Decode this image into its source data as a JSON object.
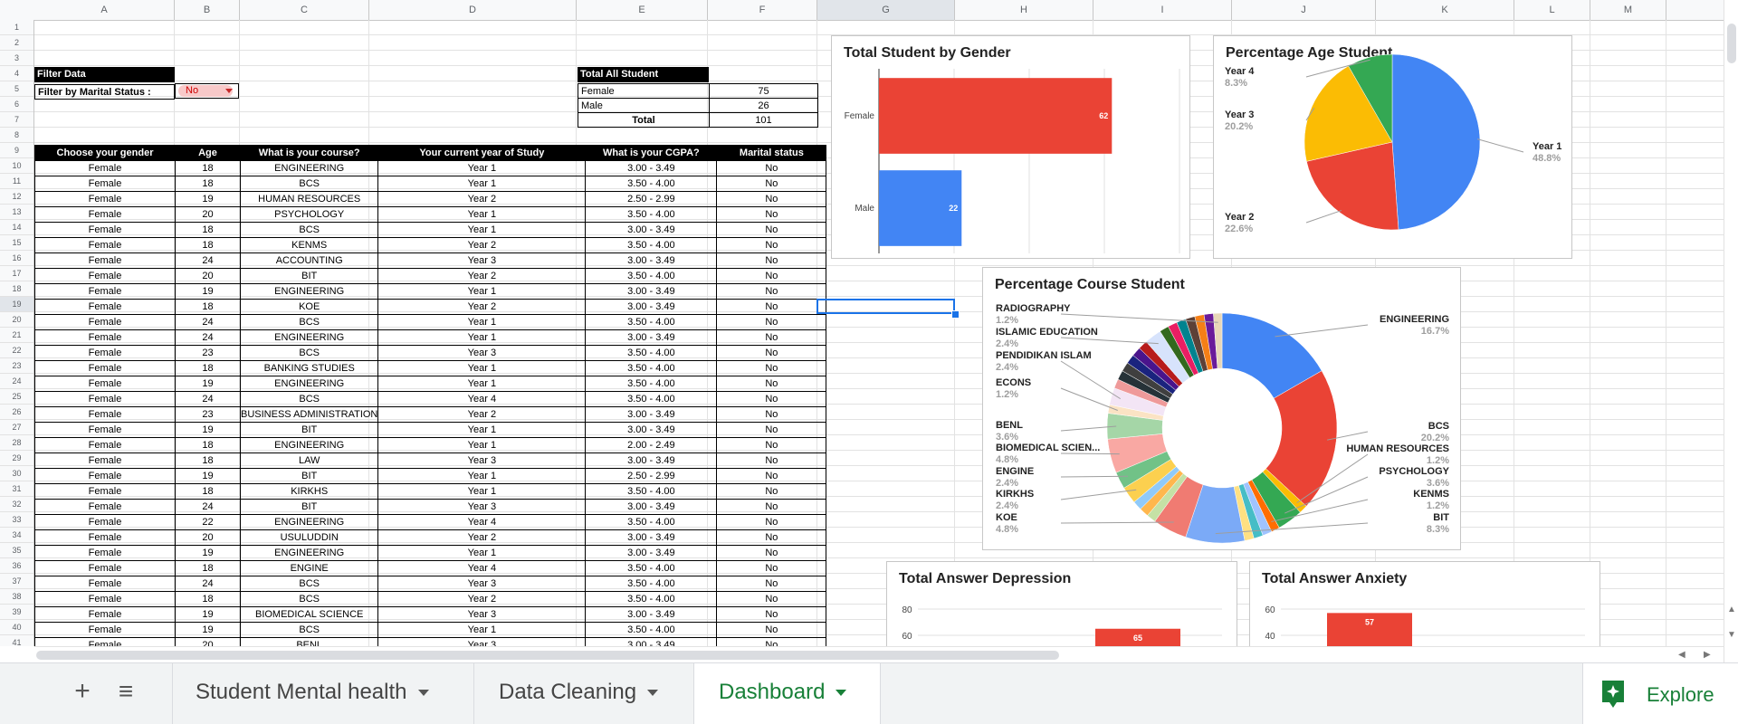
{
  "columns": [
    "A",
    "B",
    "C",
    "D",
    "E",
    "F",
    "G",
    "H",
    "I",
    "J",
    "K",
    "L",
    "M"
  ],
  "rows_visible": [
    "1",
    "2",
    "3",
    "4",
    "5",
    "6",
    "7",
    "8",
    "9",
    "10",
    "11",
    "12",
    "13",
    "14",
    "15",
    "16",
    "17",
    "18",
    "19",
    "20",
    "21",
    "22",
    "23",
    "24",
    "25",
    "26",
    "27",
    "28",
    "29",
    "30",
    "31",
    "32",
    "33",
    "34",
    "35",
    "36",
    "37",
    "38",
    "39",
    "40",
    "41"
  ],
  "filter": {
    "header": "Filter Data",
    "label": "Filter by Marital Status :",
    "value": "No"
  },
  "totals": {
    "header": "Total All Student",
    "female_label": "Female",
    "female_value": "75",
    "male_label": "Male",
    "male_value": "26",
    "total_label": "Total",
    "total_value": "101"
  },
  "table": {
    "headers": [
      "Choose your gender",
      "Age",
      "What is your course?",
      "Your current year of Study",
      "What is your CGPA?",
      "Marital status"
    ],
    "rows": [
      [
        "Female",
        "18",
        "ENGINEERING",
        "Year 1",
        "3.00 - 3.49",
        "No"
      ],
      [
        "Female",
        "18",
        "BCS",
        "Year 1",
        "3.50 - 4.00",
        "No"
      ],
      [
        "Female",
        "19",
        "HUMAN RESOURCES",
        "Year 2",
        "2.50 - 2.99",
        "No"
      ],
      [
        "Female",
        "20",
        "PSYCHOLOGY",
        "Year 1",
        "3.50 - 4.00",
        "No"
      ],
      [
        "Female",
        "18",
        "BCS",
        "Year 1",
        "3.00 - 3.49",
        "No"
      ],
      [
        "Female",
        "18",
        "KENMS",
        "Year 2",
        "3.50 - 4.00",
        "No"
      ],
      [
        "Female",
        "24",
        "ACCOUNTING",
        "Year 3",
        "3.00 - 3.49",
        "No"
      ],
      [
        "Female",
        "20",
        "BIT",
        "Year 2",
        "3.50 - 4.00",
        "No"
      ],
      [
        "Female",
        "19",
        "ENGINEERING",
        "Year 1",
        "3.00 - 3.49",
        "No"
      ],
      [
        "Female",
        "18",
        "KOE",
        "Year 2",
        "3.00 - 3.49",
        "No"
      ],
      [
        "Female",
        "24",
        "BCS",
        "Year 1",
        "3.50 - 4.00",
        "No"
      ],
      [
        "Female",
        "24",
        "ENGINEERING",
        "Year 1",
        "3.00 - 3.49",
        "No"
      ],
      [
        "Female",
        "23",
        "BCS",
        "Year 3",
        "3.50 - 4.00",
        "No"
      ],
      [
        "Female",
        "18",
        "BANKING STUDIES",
        "Year 1",
        "3.50 - 4.00",
        "No"
      ],
      [
        "Female",
        "19",
        "ENGINEERING",
        "Year 1",
        "3.50 - 4.00",
        "No"
      ],
      [
        "Female",
        "24",
        "BCS",
        "Year 4",
        "3.50 - 4.00",
        "No"
      ],
      [
        "Female",
        "23",
        "BUSINESS ADMINISTRATION",
        "Year 2",
        "3.00 - 3.49",
        "No"
      ],
      [
        "Female",
        "19",
        "BIT",
        "Year 1",
        "3.00 - 3.49",
        "No"
      ],
      [
        "Female",
        "18",
        "ENGINEERING",
        "Year 1",
        "2.00 - 2.49",
        "No"
      ],
      [
        "Female",
        "18",
        "LAW",
        "Year 3",
        "3.00 - 3.49",
        "No"
      ],
      [
        "Female",
        "19",
        "BIT",
        "Year 1",
        "2.50 - 2.99",
        "No"
      ],
      [
        "Female",
        "18",
        "KIRKHS",
        "Year 1",
        "3.50 - 4.00",
        "No"
      ],
      [
        "Female",
        "24",
        "BIT",
        "Year 3",
        "3.00 - 3.49",
        "No"
      ],
      [
        "Female",
        "22",
        "ENGINEERING",
        "Year 4",
        "3.50 - 4.00",
        "No"
      ],
      [
        "Female",
        "20",
        "USULUDDIN",
        "Year 2",
        "3.00 - 3.49",
        "No"
      ],
      [
        "Female",
        "19",
        "ENGINEERING",
        "Year 1",
        "3.00 - 3.49",
        "No"
      ],
      [
        "Female",
        "18",
        "ENGINE",
        "Year 4",
        "3.50 - 4.00",
        "No"
      ],
      [
        "Female",
        "24",
        "BCS",
        "Year 3",
        "3.50 - 4.00",
        "No"
      ],
      [
        "Female",
        "18",
        "BCS",
        "Year 2",
        "3.50 - 4.00",
        "No"
      ],
      [
        "Female",
        "19",
        "BIOMEDICAL SCIENCE",
        "Year 3",
        "3.00 - 3.49",
        "No"
      ],
      [
        "Female",
        "19",
        "BCS",
        "Year 1",
        "3.50 - 4.00",
        "No"
      ],
      [
        "Female",
        "20",
        "BENL",
        "Year 3",
        "3.00 - 3.49",
        "No"
      ]
    ]
  },
  "chart_data": [
    {
      "type": "bar",
      "orientation": "horizontal",
      "title": "Total Student by Gender",
      "categories": [
        "Female",
        "Male"
      ],
      "values": [
        62,
        22
      ],
      "colors": [
        "#ea4335",
        "#4285f4"
      ],
      "xlim": [
        0,
        80
      ],
      "ticks": [
        "0",
        "20",
        "40",
        "60",
        "80"
      ]
    },
    {
      "type": "pie",
      "title": "Percentage Age Student",
      "labels": [
        "Year 1",
        "Year 2",
        "Year 3",
        "Year 4"
      ],
      "values": [
        48.8,
        22.6,
        20.2,
        8.3
      ],
      "pct_labels": [
        "48.8%",
        "22.6%",
        "20.2%",
        "8.3%"
      ],
      "colors": [
        "#4285f4",
        "#ea4335",
        "#fbbc04",
        "#34a853"
      ]
    },
    {
      "type": "pie",
      "donut": true,
      "title": "Percentage Course Student",
      "labels": [
        "ENGINEERING",
        "BCS",
        "HUMAN RESOURCES",
        "PSYCHOLOGY",
        "KENMS",
        "BIT",
        "KOE",
        "KIRKHS",
        "ENGINE",
        "BIOMEDICAL SCIEN...",
        "BENL",
        "ECONS",
        "PENDIDIKAN ISLAM",
        "ISLAMIC EDUCATION",
        "RADIOGRAPHY"
      ],
      "values": [
        16.7,
        20.2,
        1.2,
        3.6,
        1.2,
        8.3,
        4.8,
        2.4,
        2.4,
        4.8,
        3.6,
        1.2,
        2.4,
        2.4,
        1.2
      ],
      "pct_labels": [
        "16.7%",
        "20.2%",
        "1.2%",
        "3.6%",
        "1.2%",
        "8.3%",
        "4.8%",
        "2.4%",
        "2.4%",
        "4.8%",
        "3.6%",
        "1.2%",
        "2.4%",
        "2.4%",
        "1.2%"
      ],
      "colors": [
        "#4285f4",
        "#ea4335",
        "#fbbc04",
        "#34a853",
        "#ff6d01",
        "#7baaf7",
        "#f07b72",
        "#fcd04f",
        "#71c287",
        "#f9a8a3",
        "#a5d6a7",
        "#fbe3c4",
        "#f3e5f5",
        "#d7e3fc",
        "#e8d7b8"
      ],
      "extra_colors": [
        "#a0c3ff",
        "#46bdc6",
        "#ffe082",
        "#c5e1a5",
        "#ffb74d",
        "#90caf9",
        "#ef9a9a",
        "#263238",
        "#3f3f3f",
        "#1a237e",
        "#4a148c",
        "#b71c1c",
        "#33691e",
        "#e91e63",
        "#00838f",
        "#5d4037",
        "#f57f17",
        "#6a1b9a"
      ]
    },
    {
      "type": "bar",
      "title": "Total Answer Depression",
      "categories": [
        ""
      ],
      "values": [
        65
      ],
      "ylim": [
        0,
        80
      ],
      "ticks": [
        "80",
        "60"
      ],
      "colors": [
        "#ea4335"
      ]
    },
    {
      "type": "bar",
      "title": "Total Answer Anxiety",
      "categories": [
        ""
      ],
      "values": [
        57
      ],
      "ylim": [
        0,
        60
      ],
      "ticks": [
        "60",
        "40"
      ],
      "colors": [
        "#ea4335"
      ]
    }
  ],
  "tabs": {
    "add_icon": "+",
    "menu_icon": "≡",
    "items": [
      {
        "label": "Student Mental health"
      },
      {
        "label": "Data Cleaning"
      },
      {
        "label": "Dashboard"
      }
    ],
    "explore": "Explore"
  }
}
